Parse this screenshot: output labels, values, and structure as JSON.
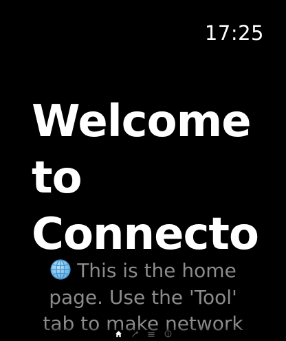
{
  "status_bar": {
    "time": "17:25"
  },
  "home": {
    "title_lines": [
      "Welcome",
      "to",
      "Connecto"
    ],
    "body_icon": "globe-icon",
    "body_lines": [
      "This is the home",
      "page. Use the 'Tool'",
      "tab to make network"
    ]
  },
  "tab_bar": {
    "items": [
      {
        "icon": "home-icon",
        "active": true
      },
      {
        "icon": "tool-icon",
        "active": false
      },
      {
        "icon": "list-icon",
        "active": false
      },
      {
        "icon": "info-icon",
        "active": false
      }
    ]
  },
  "colors": {
    "background": "#000000",
    "title": "#ffffff",
    "body_text": "#8c8c8c",
    "tab_active": "#ffffff",
    "tab_inactive": "#5a5a5a"
  }
}
